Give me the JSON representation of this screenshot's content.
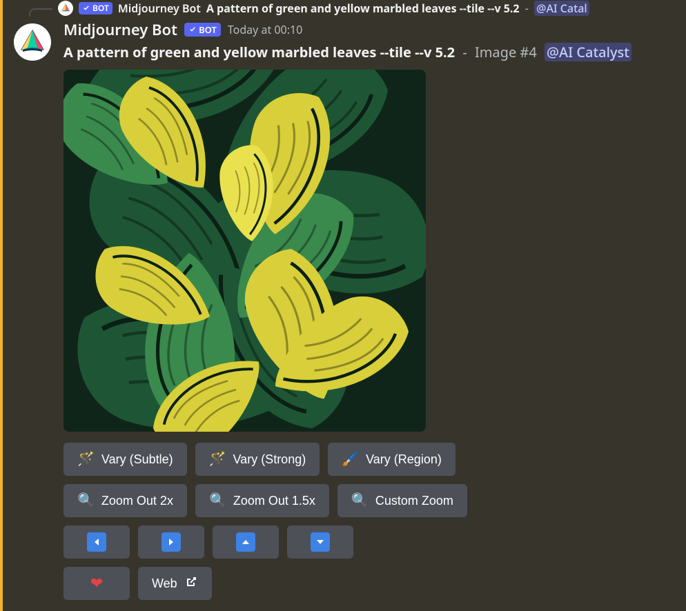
{
  "reply": {
    "author": "Midjourney Bot",
    "bot_label": "BOT",
    "content_bold": "A pattern of green and yellow marbled leaves --tile --v 5.2",
    "content_sep": "-",
    "mention": "@AI Catal"
  },
  "message": {
    "author": "Midjourney Bot",
    "bot_label": "BOT",
    "timestamp": "Today at 00:10",
    "prompt_bold": "A pattern of green and yellow marbled leaves --tile --v 5.2",
    "sep": "-",
    "image_suffix": "Image #4",
    "mention": "@AI Catalyst"
  },
  "buttons": {
    "row1": [
      {
        "emoji": "🪄",
        "label": "Vary (Subtle)",
        "name": "vary-subtle-button"
      },
      {
        "emoji": "🪄",
        "label": "Vary (Strong)",
        "name": "vary-strong-button"
      },
      {
        "emoji": "🖌️",
        "label": "Vary (Region)",
        "name": "vary-region-button"
      }
    ],
    "row2": [
      {
        "emoji": "🔍",
        "label": "Zoom Out 2x",
        "name": "zoom-out-2x-button"
      },
      {
        "emoji": "🔍",
        "label": "Zoom Out 1.5x",
        "name": "zoom-out-1-5x-button"
      },
      {
        "emoji": "🔍",
        "label": "Custom Zoom",
        "name": "custom-zoom-button"
      }
    ],
    "row3": [
      {
        "dir": "left",
        "name": "pan-left-button"
      },
      {
        "dir": "right",
        "name": "pan-right-button"
      },
      {
        "dir": "up",
        "name": "pan-up-button"
      },
      {
        "dir": "down",
        "name": "pan-down-button"
      }
    ],
    "row4": {
      "heart_name": "heart-button",
      "web_label": "Web",
      "web_name": "web-button"
    }
  }
}
